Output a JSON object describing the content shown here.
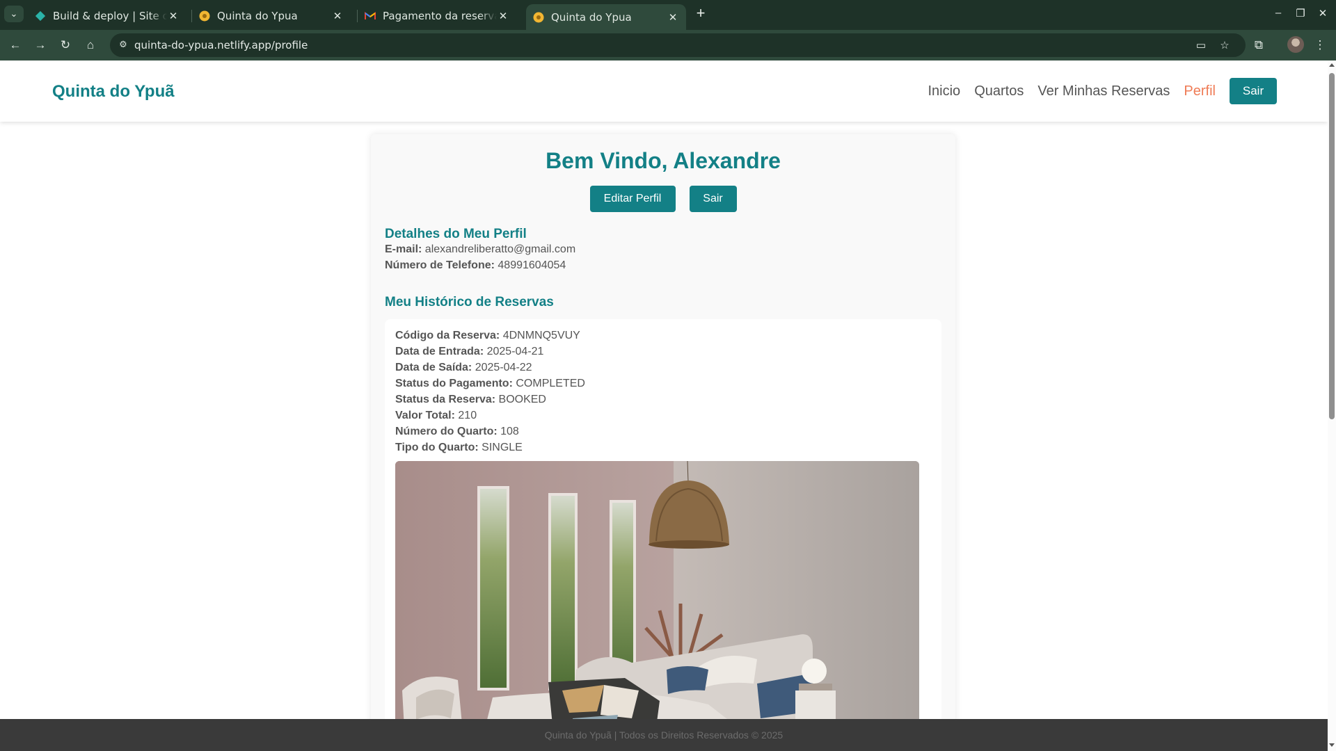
{
  "browser": {
    "tabs": [
      {
        "title": "Build & deploy | Site configuration",
        "icon": "netlify-icon"
      },
      {
        "title": "Quinta do Ypua",
        "icon": "site-favicon"
      },
      {
        "title": "Pagamento da reserva realizado",
        "icon": "gmail-icon"
      },
      {
        "title": "Quinta do Ypua",
        "icon": "site-favicon",
        "active": true
      }
    ],
    "url": "quinta-do-ypua.netlify.app/profile"
  },
  "site": {
    "logo": "Quinta do Ypuã",
    "nav": [
      "Inicio",
      "Quartos",
      "Ver Minhas Reservas",
      "Perfil"
    ],
    "logout_label": "Sair",
    "accent": "#138086",
    "active_color": "#ef7b55"
  },
  "profile": {
    "welcome": "Bem Vindo, Alexandre",
    "edit_label": "Editar Perfil",
    "logout_label": "Sair",
    "details_heading": "Detalhes do Meu Perfil",
    "email_label": "E-mail:",
    "email": "alexandreliberatto@gmail.com",
    "phone_label": "Número de Telefone:",
    "phone": "48991604054",
    "history_heading": "Meu Histórico de Reservas"
  },
  "booking": {
    "code_label": "Código da Reserva:",
    "code": "4DNMNQ5VUY",
    "checkin_label": "Data de Entrada:",
    "checkin": "2025-04-21",
    "checkout_label": "Data de Saída:",
    "checkout": "2025-04-22",
    "payment_label": "Status do Pagamento:",
    "payment": "COMPLETED",
    "status_label": "Status da Reserva:",
    "status": "BOOKED",
    "total_label": "Valor Total:",
    "total": "210",
    "room_number_label": "Número do Quarto:",
    "room_number": "108",
    "room_type_label": "Tipo do Quarto:",
    "room_type": "SINGLE"
  },
  "footer": {
    "text": "Quinta do Ypuã | Todos os Direitos Reservados © 2025"
  }
}
